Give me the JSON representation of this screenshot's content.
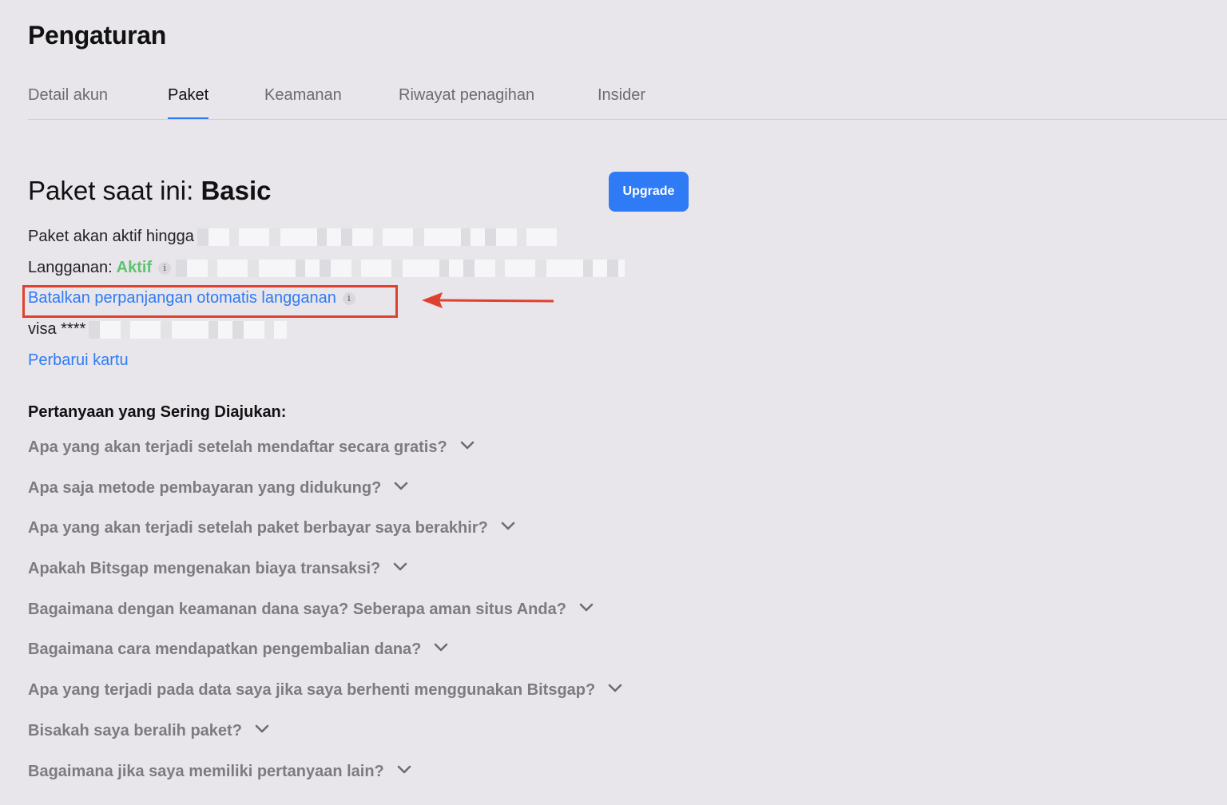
{
  "page": {
    "title": "Pengaturan"
  },
  "tabs": [
    {
      "label": "Detail akun"
    },
    {
      "label": "Paket"
    },
    {
      "label": "Keamanan"
    },
    {
      "label": "Riwayat penagihan"
    },
    {
      "label": "Insider"
    }
  ],
  "active_tab": "Paket",
  "plan": {
    "heading_prefix": "Paket saat ini:",
    "plan_name": "Basic",
    "upgrade_label": "Upgrade",
    "active_until_label": "Paket akan aktif hingga",
    "subscription_label": "Langganan:",
    "subscription_status": "Aktif",
    "cancel_auto_renew_label": "Batalkan perpanjangan otomatis langganan",
    "card_label": "visa ****",
    "update_card_label": "Perbarui kartu"
  },
  "faq": {
    "title": "Pertanyaan yang Sering Diajukan:",
    "items": [
      {
        "question": "Apa yang akan terjadi setelah mendaftar secara gratis?"
      },
      {
        "question": "Apa saja metode pembayaran yang didukung?"
      },
      {
        "question": "Apa yang akan terjadi setelah paket berbayar saya berakhir?"
      },
      {
        "question": "Apakah Bitsgap mengenakan biaya transaksi?"
      },
      {
        "question": "Bagaimana dengan keamanan dana saya? Seberapa aman situs Anda?"
      },
      {
        "question": "Bagaimana cara mendapatkan pengembalian dana?"
      },
      {
        "question": "Apa yang terjadi pada data saya jika saya berhenti menggunakan Bitsgap?"
      },
      {
        "question": "Bisakah saya beralih paket?"
      },
      {
        "question": "Bagaimana jika saya memiliki pertanyaan lain?"
      }
    ]
  },
  "colors": {
    "background": "#e8e6eb",
    "accent": "#2f7bf5",
    "status_active": "#5cc46a",
    "annotation": "#e0412f"
  },
  "icons": {
    "info": "info-icon",
    "chevron": "chevron-down-icon",
    "annotation_arrow": "arrow-left-icon"
  }
}
